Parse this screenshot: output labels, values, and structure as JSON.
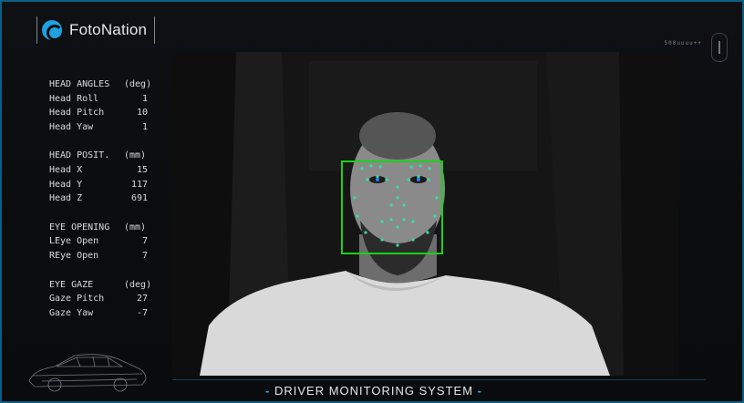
{
  "brand": {
    "name": "FotoNation",
    "logo_icon": "fotonation-logo-icon",
    "accent": "#1fa3e0"
  },
  "hud": {
    "corner_text": "500uuuu++"
  },
  "stats": [
    {
      "header": "HEAD ANGLES",
      "unit": "(deg)",
      "rows": [
        {
          "label": "Head Roll",
          "value": "1"
        },
        {
          "label": "Head Pitch",
          "value": "10"
        },
        {
          "label": "Head Yaw",
          "value": "1"
        }
      ]
    },
    {
      "header": "HEAD POSIT.",
      "unit": "(mm)",
      "rows": [
        {
          "label": "Head X",
          "value": "15"
        },
        {
          "label": "Head Y",
          "value": "117"
        },
        {
          "label": "Head Z",
          "value": "691"
        }
      ]
    },
    {
      "header": "EYE OPENING",
      "unit": "(mm)",
      "rows": [
        {
          "label": "LEye Open",
          "value": "7"
        },
        {
          "label": "REye Open",
          "value": "7"
        }
      ]
    },
    {
      "header": "EYE GAZE",
      "unit": "(deg)",
      "rows": [
        {
          "label": "Gaze Pitch",
          "value": "27"
        },
        {
          "label": "Gaze Yaw",
          "value": "-7"
        }
      ]
    }
  ],
  "video": {
    "face_box_color": "#19d219",
    "landmark_color": "#35e0a0"
  },
  "footer": {
    "title": "DRIVER MONITORING SYSTEM",
    "dash": "-",
    "accent": "#29a9ea"
  }
}
